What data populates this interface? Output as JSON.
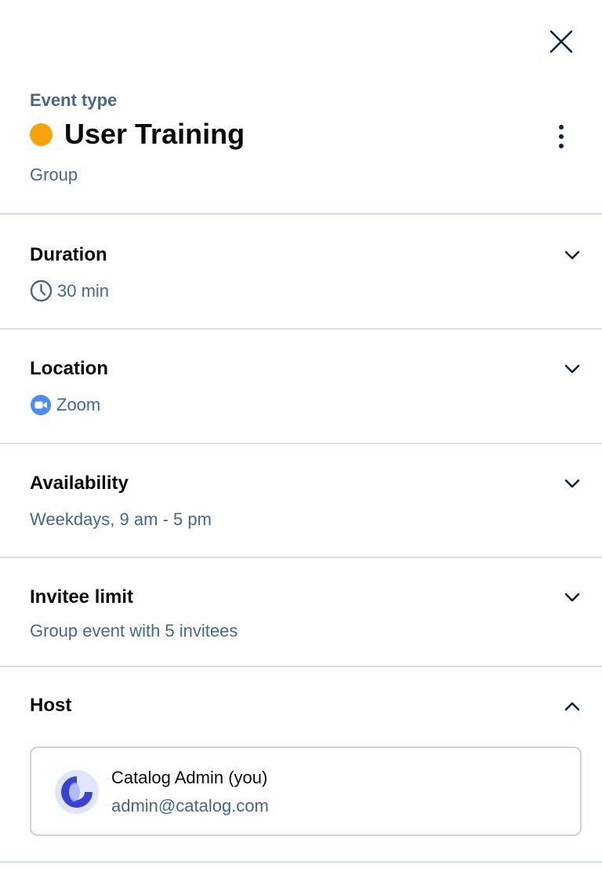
{
  "header": {
    "event_type_label": "Event type",
    "event_title": "User Training",
    "event_kind": "Group",
    "event_color": "#f8a30c"
  },
  "sections": {
    "duration": {
      "title": "Duration",
      "value": "30 min",
      "icon": "clock-icon"
    },
    "location": {
      "title": "Location",
      "value": "Zoom",
      "icon": "zoom-icon"
    },
    "availability": {
      "title": "Availability",
      "value": "Weekdays, 9 am - 5 pm"
    },
    "invitee_limit": {
      "title": "Invitee limit",
      "value": "Group event with 5 invitees"
    },
    "host": {
      "title": "Host",
      "expanded": true,
      "name": "Catalog Admin (you)",
      "email": "admin@catalog.com"
    }
  },
  "colors": {
    "accent_text": "#476788",
    "divider": "#d6dfe9",
    "zoom_blue": "#4a8cff",
    "avatar_blue": "#3a42d6"
  }
}
